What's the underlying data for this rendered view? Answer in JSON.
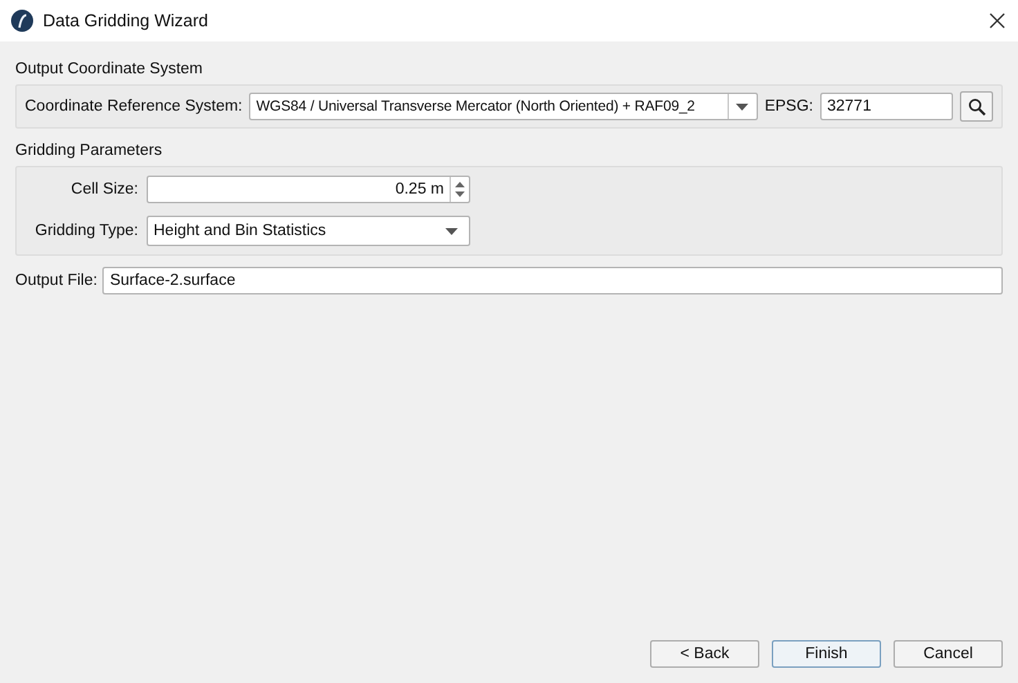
{
  "window": {
    "title": "Data Gridding Wizard"
  },
  "output_coordinate_system": {
    "heading": "Output Coordinate System",
    "crs_label": "Coordinate Reference System:",
    "crs_value": "WGS84 / Universal Transverse Mercator (North Oriented) + RAF09_2",
    "epsg_label": "EPSG:",
    "epsg_value": "32771"
  },
  "gridding_parameters": {
    "heading": "Gridding Parameters",
    "cell_size_label": "Cell Size:",
    "cell_size_value": "0.25 m",
    "gridding_type_label": "Gridding Type:",
    "gridding_type_value": "Height and Bin Statistics"
  },
  "output_file": {
    "label": "Output File:",
    "value": "Surface-2.surface"
  },
  "buttons": [
    {
      "label": "< Back",
      "default": false
    },
    {
      "label": "Finish",
      "default": true
    },
    {
      "label": "Cancel",
      "default": false
    }
  ]
}
